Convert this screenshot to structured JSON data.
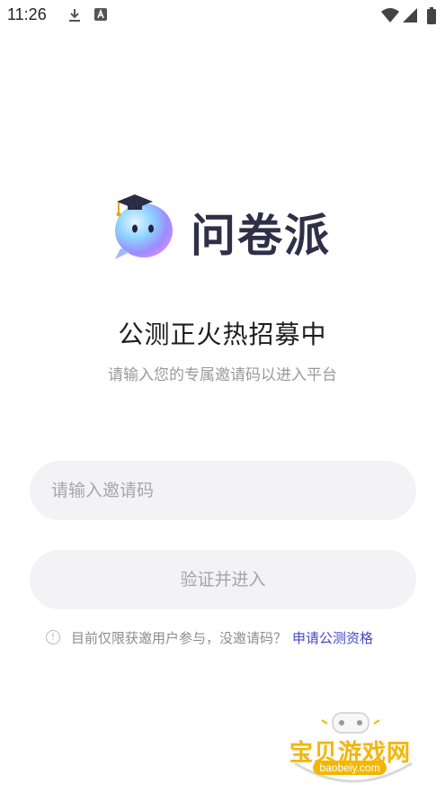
{
  "status_bar": {
    "time": "11:26",
    "icons": [
      "download-icon",
      "a-box-icon",
      "wifi-icon",
      "signal-icon",
      "battery-icon"
    ]
  },
  "logo": {
    "title": "问卷派",
    "mascot": "mascot-bubble-icon"
  },
  "headline": "公测正火热招募中",
  "subline": "请输入您的专属邀请码以进入平台",
  "invite_input": {
    "placeholder": "请输入邀请码",
    "value": ""
  },
  "verify_button": "验证并进入",
  "notice": {
    "icon": "info-circle-icon",
    "text": "目前仅限获邀用户参与，没邀请码？",
    "link": "申请公测资格"
  },
  "watermark": {
    "text": "宝贝游戏网",
    "url": "baobeiy.com"
  },
  "colors": {
    "background": "#ffffff",
    "input_bg": "#f3f3f5",
    "link": "#4747c8",
    "title": "#2f3048",
    "watermark": "#f2b705"
  }
}
